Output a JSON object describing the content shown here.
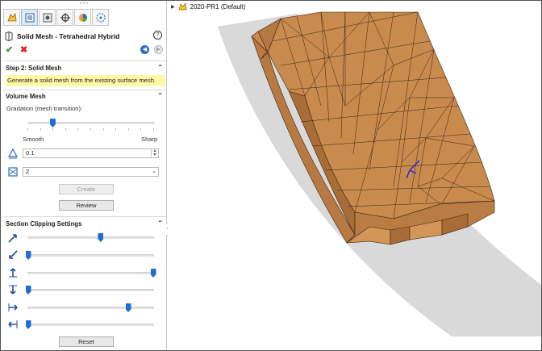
{
  "panel": {
    "title": "Solid Mesh - Tetrahedral Hybrid",
    "help": "?",
    "ok": "✔",
    "cancel": "✖",
    "step_section": {
      "heading": "Step 2: Solid Mesh",
      "instruction": "Generate a solid mesh from the existing surface mesh."
    },
    "volume_mesh": {
      "heading": "Volume Mesh",
      "gradation_label": "Gradation (mesh transition):",
      "gradation_value": 0.2,
      "smooth_label": "Smooth",
      "sharp_label": "Sharp",
      "size_value": "0.1",
      "count_value": "2",
      "create_label": "Create",
      "review_label": "Review"
    },
    "clipping": {
      "heading": "Section Clipping Settings",
      "sliders": [
        {
          "name": "x-positive",
          "value": 0.58
        },
        {
          "name": "x-negative",
          "value": 0.0
        },
        {
          "name": "y-positive",
          "value": 1.0
        },
        {
          "name": "y-negative",
          "value": 0.0
        },
        {
          "name": "z-positive",
          "value": 0.8
        },
        {
          "name": "z-negative",
          "value": 0.0
        }
      ],
      "reset_label": "Reset"
    }
  },
  "tree": {
    "item": "2020-PR1  (Default)"
  },
  "colors": {
    "accent": "#1e6fd0",
    "mesh_fill": "#c98a4e",
    "mesh_edge": "#3a2410",
    "ground": "#d9d9d9",
    "tip_bg": "#fef9a5"
  }
}
